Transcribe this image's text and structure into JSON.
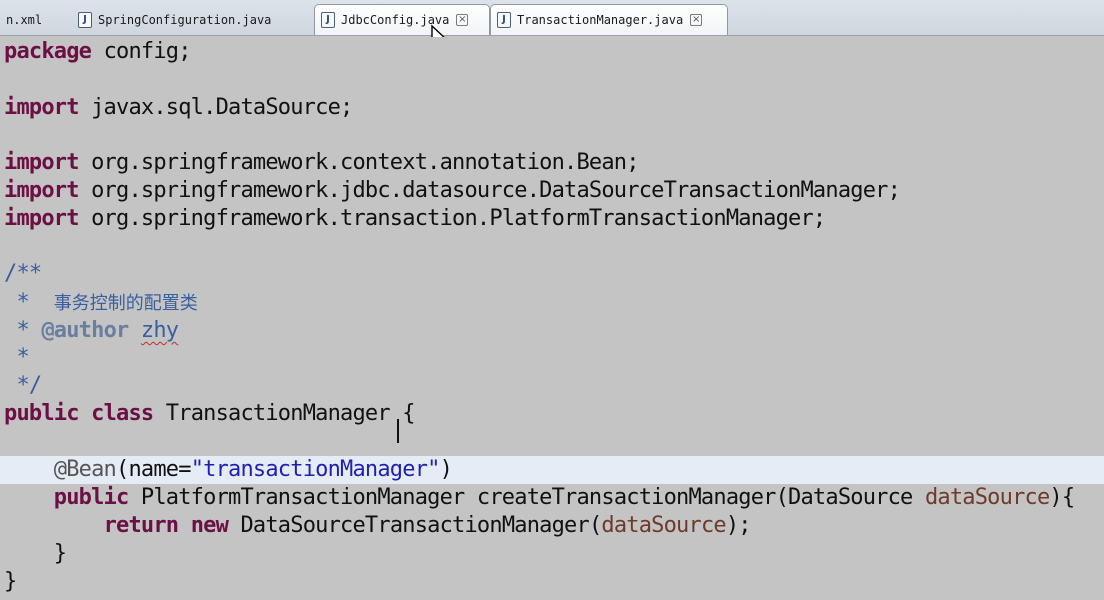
{
  "tabs": [
    {
      "label": "n.xml",
      "active": false,
      "has_java_icon": false
    },
    {
      "label": "SpringConfiguration.java",
      "active": false,
      "has_java_icon": true
    },
    {
      "label": "JdbcConfig.java",
      "active": true,
      "has_java_icon": true
    },
    {
      "label": "TransactionManager.java",
      "active": true,
      "has_java_icon": true
    }
  ],
  "code": {
    "l1_kw": "package",
    "l1_rest": " config;",
    "l3_kw": "import",
    "l3_rest": " javax.sql.DataSource;",
    "l5_kw": "import",
    "l5_rest": " org.springframework.context.annotation.Bean;",
    "l6_kw": "import",
    "l6_rest": " org.springframework.jdbc.datasource.DataSourceTransactionManager;",
    "l7_kw": "import",
    "l7_rest": " org.springframework.transaction.PlatformTransactionManager;",
    "c1": "/**",
    "c2_star": " *  ",
    "c2_text": "事务控制的配置类",
    "c3_star": " * ",
    "c3_tag": "@author",
    "c3_sp": " ",
    "c3_name": "zhy",
    "c4": " *",
    "c5": " */",
    "cls_kw1": "public",
    "cls_sp": " ",
    "cls_kw2": "class",
    "cls_rest": " TransactionManager {",
    "ann_indent": "    ",
    "ann_at": "@Bean",
    "ann_open": "(name=",
    "ann_str": "\"transactionManager\"",
    "ann_close": ")",
    "m_indent": "    ",
    "m_kw": "public",
    "m_mid": " PlatformTransactionManager createTransactionManager(DataSource ",
    "m_var": "dataSource",
    "m_end": "){",
    "r_indent": "        ",
    "r_kw1": "return",
    "r_sp": " ",
    "r_kw2": "new",
    "r_mid": " DataSourceTransactionManager(",
    "r_var": "dataSource",
    "r_end": ");",
    "b1": "    }",
    "b2": "}"
  },
  "colors": {
    "editor_bg": "#c4c4c4",
    "keyword": "#6b0f45",
    "comment": "#3a5fa0",
    "string": "#1f1fb4",
    "current_line": "#e6ecf6"
  }
}
